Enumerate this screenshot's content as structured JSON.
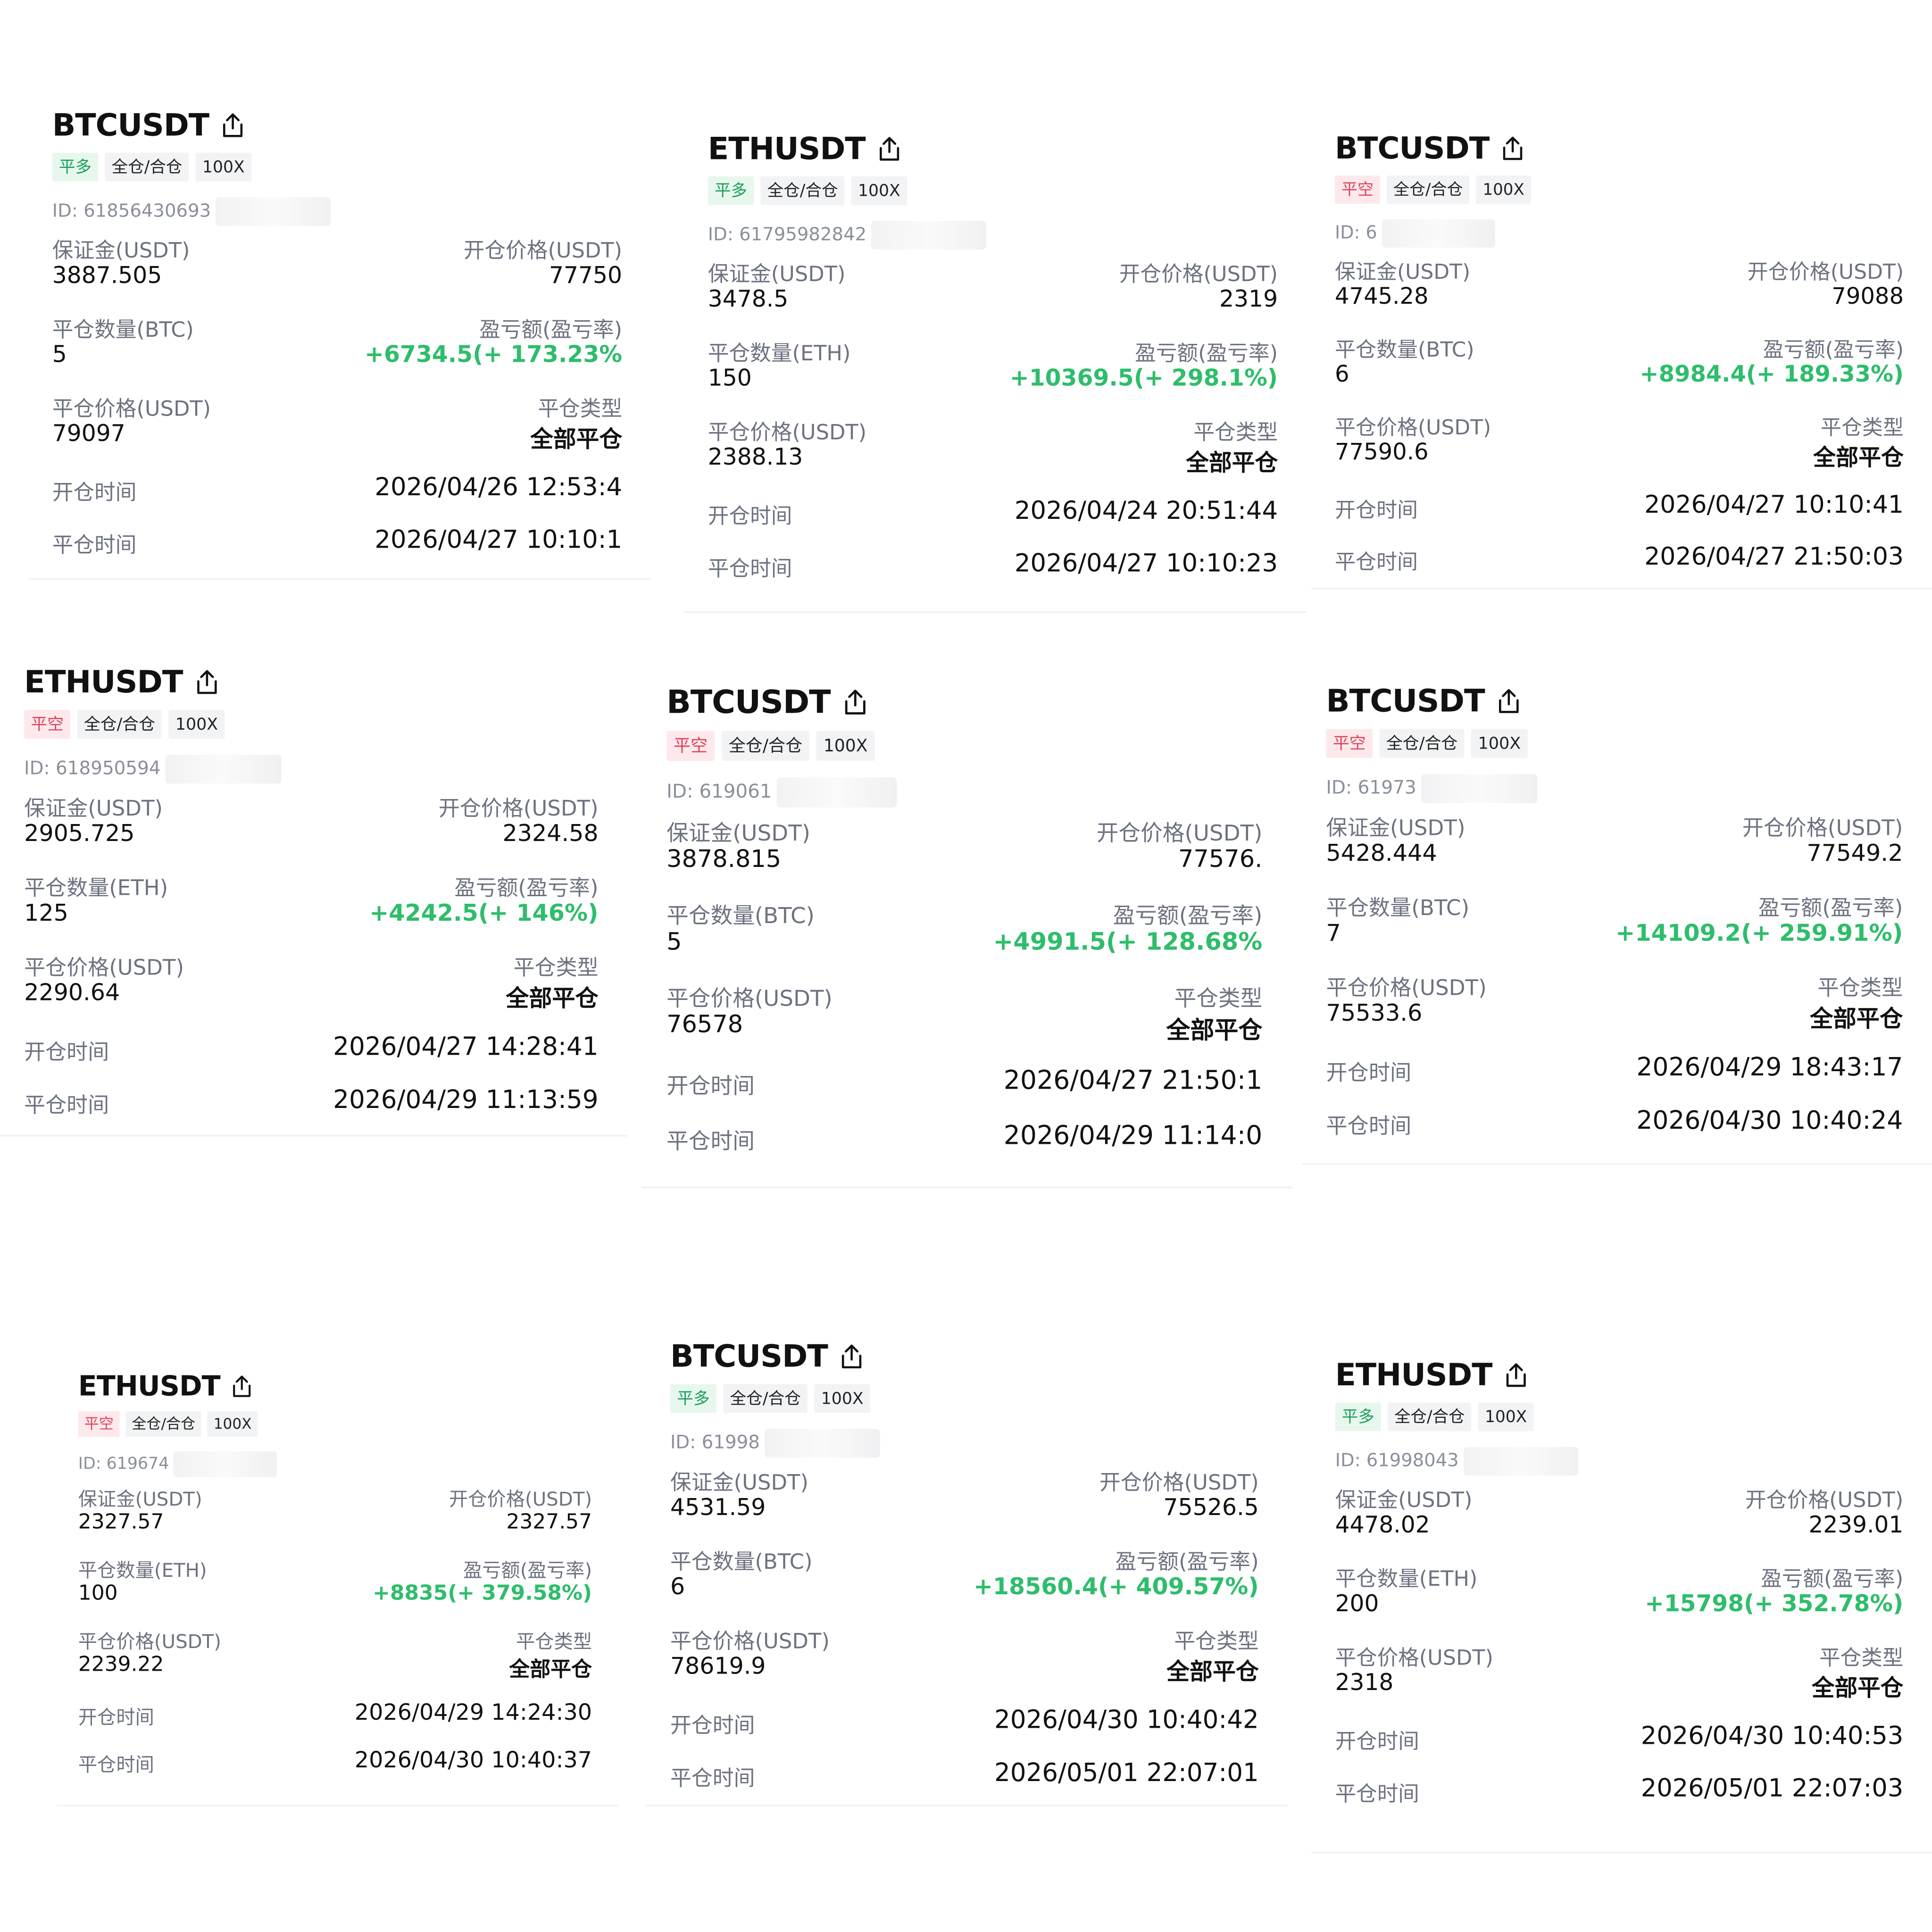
{
  "labels": {
    "margin": "保证金(USDT)",
    "open_price": "开仓价格(USDT)",
    "close_qty_btc": "平仓数量(BTC)",
    "close_qty_eth": "平仓数量(ETH)",
    "pnl": "盈亏额(盈亏率)",
    "close_price": "平仓价格(USDT)",
    "close_type": "平仓类型",
    "open_time": "开仓时间",
    "close_time": "平仓时间"
  },
  "colors": {
    "profit": "#2ebd6b",
    "long_tag": "#1a9f5a",
    "short_tag": "#e0415b"
  },
  "cards": [
    {
      "symbol": "BTCUSDT",
      "side": "平多",
      "margin_mode": "全仓/合仓",
      "leverage": "100X",
      "id": "ID: 61856430693",
      "margin": "3887.505",
      "open_price": "77750",
      "qty_label": "平仓数量(BTC)",
      "qty": "5",
      "pnl": "+6734.5(+ 173.23%",
      "close_price": "79097",
      "close_type": "全部平仓",
      "open_time": "2026/04/26 12:53:4",
      "close_time": "2026/04/27 10:10:1"
    },
    {
      "symbol": "ETHUSDT",
      "side": "平多",
      "margin_mode": "全仓/合仓",
      "leverage": "100X",
      "id": "ID: 61795982842",
      "margin": "3478.5",
      "open_price": "2319",
      "qty_label": "平仓数量(ETH)",
      "qty": "150",
      "pnl": "+10369.5(+ 298.1%)",
      "close_price": "2388.13",
      "close_type": "全部平仓",
      "open_time": "2026/04/24 20:51:44",
      "close_time": "2026/04/27 10:10:23"
    },
    {
      "symbol": "BTCUSDT",
      "side": "平空",
      "margin_mode": "全仓/合仓",
      "leverage": "100X",
      "id": "ID: 6",
      "margin": "4745.28",
      "open_price": "79088",
      "qty_label": "平仓数量(BTC)",
      "qty": "6",
      "pnl": "+8984.4(+ 189.33%)",
      "close_price": "77590.6",
      "close_type": "全部平仓",
      "open_time": "2026/04/27 10:10:41",
      "close_time": "2026/04/27 21:50:03"
    },
    {
      "symbol": "ETHUSDT",
      "side": "平空",
      "margin_mode": "全仓/合仓",
      "leverage": "100X",
      "id": "ID: 618950594",
      "margin": "2905.725",
      "open_price": "2324.58",
      "qty_label": "平仓数量(ETH)",
      "qty": "125",
      "pnl": "+4242.5(+ 146%)",
      "close_price": "2290.64",
      "close_type": "全部平仓",
      "open_time": "2026/04/27 14:28:41",
      "close_time": "2026/04/29 11:13:59"
    },
    {
      "symbol": "BTCUSDT",
      "side": "平空",
      "margin_mode": "全仓/合仓",
      "leverage": "100X",
      "id": "ID: 619061",
      "margin": "3878.815",
      "open_price": "77576.",
      "qty_label": "平仓数量(BTC)",
      "qty": "5",
      "pnl": "+4991.5(+ 128.68%",
      "close_price": "76578",
      "close_type": "全部平仓",
      "open_time": "2026/04/27 21:50:1",
      "close_time": "2026/04/29 11:14:0"
    },
    {
      "symbol": "BTCUSDT",
      "side": "平空",
      "margin_mode": "全仓/合仓",
      "leverage": "100X",
      "id": "ID: 61973",
      "margin": "5428.444",
      "open_price": "77549.2",
      "qty_label": "平仓数量(BTC)",
      "qty": "7",
      "pnl": "+14109.2(+ 259.91%)",
      "close_price": "75533.6",
      "close_type": "全部平仓",
      "open_time": "2026/04/29 18:43:17",
      "close_time": "2026/04/30 10:40:24"
    },
    {
      "symbol": "ETHUSDT",
      "side": "平空",
      "margin_mode": "全仓/合仓",
      "leverage": "100X",
      "id": "ID: 619674",
      "margin": "2327.57",
      "open_price": "2327.57",
      "qty_label": "平仓数量(ETH)",
      "qty": "100",
      "pnl": "+8835(+ 379.58%)",
      "close_price": "2239.22",
      "close_type": "全部平仓",
      "open_time": "2026/04/29 14:24:30",
      "close_time": "2026/04/30 10:40:37"
    },
    {
      "symbol": "BTCUSDT",
      "side": "平多",
      "margin_mode": "全仓/合仓",
      "leverage": "100X",
      "id": "ID: 61998",
      "margin": "4531.59",
      "open_price": "75526.5",
      "qty_label": "平仓数量(BTC)",
      "qty": "6",
      "pnl": "+18560.4(+ 409.57%)",
      "close_price": "78619.9",
      "close_type": "全部平仓",
      "open_time": "2026/04/30 10:40:42",
      "close_time": "2026/05/01 22:07:01"
    },
    {
      "symbol": "ETHUSDT",
      "side": "平多",
      "margin_mode": "全仓/合仓",
      "leverage": "100X",
      "id": "ID: 61998043",
      "margin": "4478.02",
      "open_price": "2239.01",
      "qty_label": "平仓数量(ETH)",
      "qty": "200",
      "pnl": "+15798(+ 352.78%)",
      "close_price": "2318",
      "close_type": "全部平仓",
      "open_time": "2026/04/30 10:40:53",
      "close_time": "2026/05/01 22:07:03"
    }
  ]
}
